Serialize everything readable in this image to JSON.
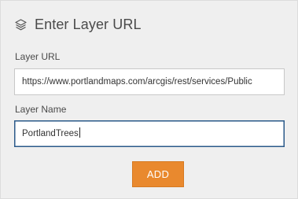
{
  "header": {
    "icon": "layers-icon",
    "title": "Enter Layer URL"
  },
  "form": {
    "layer_url": {
      "label": "Layer URL",
      "value": "https://www.portlandmaps.com/arcgis/rest/services/Public"
    },
    "layer_name": {
      "label": "Layer Name",
      "value": "PortlandTrees"
    },
    "add_button": {
      "label": "ADD"
    }
  },
  "colors": {
    "panel_background": "#efefef",
    "accent_button": "#e9892e",
    "focus_border": "#2b5a8a"
  }
}
